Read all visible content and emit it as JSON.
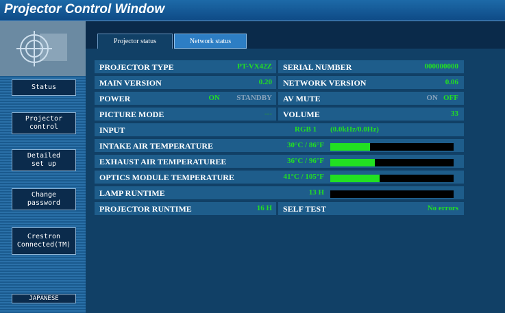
{
  "window": {
    "title": "Projector Control Window"
  },
  "sidebar": {
    "items": [
      {
        "label": "Status"
      },
      {
        "label": "Projector\ncontrol"
      },
      {
        "label": "Detailed\nset up"
      },
      {
        "label": "Change\npassword"
      },
      {
        "label": "Crestron\nConnected(TM)"
      }
    ],
    "language_button": "JAPANESE"
  },
  "tabs": {
    "projector_status": "Projector status",
    "network_status": "Network status"
  },
  "status": {
    "projector_type": {
      "label": "PROJECTOR TYPE",
      "value": "PT-VX42Z"
    },
    "serial_number": {
      "label": "SERIAL NUMBER",
      "value": "000000000"
    },
    "main_version": {
      "label": "MAIN VERSION",
      "value": "0.20"
    },
    "network_version": {
      "label": "NETWORK VERSION",
      "value": "0.06"
    },
    "power": {
      "label": "POWER",
      "on": "ON",
      "standby": "STANDBY"
    },
    "av_mute": {
      "label": "AV MUTE",
      "on": "ON",
      "off": "OFF"
    },
    "picture_mode": {
      "label": "PICTURE MODE",
      "value": "---"
    },
    "volume": {
      "label": "VOLUME",
      "value": "33"
    },
    "input": {
      "label": "INPUT",
      "value": "RGB 1",
      "detail": "(0.0kHz/0.0Hz)"
    },
    "intake_air_temperature": {
      "label": "INTAKE AIR TEMPERATURE",
      "value": "30°C / 86°F",
      "level": 0.32
    },
    "exhaust_air_temperature": {
      "label": "EXHAUST AIR TEMPERATUREE",
      "value": "36°C / 96°F",
      "level": 0.36
    },
    "optics_module_temperature": {
      "label": "OPTICS MODULE TEMPERATURE",
      "value": "41°C / 105°F",
      "level": 0.4
    },
    "lamp_runtime": {
      "label": "LAMP RUNTIME",
      "value": "13 H",
      "level": 0.0
    },
    "projector_runtime": {
      "label": "PROJECTOR RUNTIME",
      "value": "16 H"
    },
    "self_test": {
      "label": "SELF TEST",
      "value": "No errors"
    }
  },
  "colors": {
    "value_green": "#22e022",
    "row_bg": "#1e5d8b",
    "background": "#0a2a4a"
  }
}
